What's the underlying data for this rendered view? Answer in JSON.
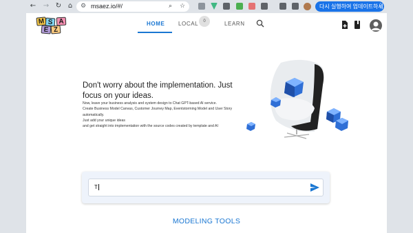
{
  "browser": {
    "url": "msaez.io/#/",
    "update_button": "다시 실행하여 업데이트하세요.",
    "nav": {
      "back": "←",
      "forward": "→",
      "reload": "↻",
      "home": "⌂",
      "menu": "⋮"
    },
    "icons": [
      "site-settings-icon",
      "zoom-icon",
      "bookmark-star-icon"
    ]
  },
  "app": {
    "logo_letters": [
      "M",
      "S",
      "A",
      "E",
      "Z"
    ],
    "tabs": [
      {
        "label": "HOME",
        "active": true
      },
      {
        "label": "LOCAL",
        "badge": "0"
      },
      {
        "label": "LEARN"
      }
    ],
    "accent_color": "#1976d2"
  },
  "hero": {
    "headline": "Don't worry about the implementation. Just focus on your ideas.",
    "lines": [
      "Now, leave your business analysis and system design to Chat GPT-based AI service.",
      "Create Business Model Canvas, Customer Journey Map, Eventstorming Model and User Story",
      "automatically.",
      "Just add your unique ideas",
      "and get straight into implementation with the source codes created by template and AI"
    ]
  },
  "prompt": {
    "value": "T"
  },
  "sections": {
    "modeling_tools": "MODELING TOOLS"
  }
}
